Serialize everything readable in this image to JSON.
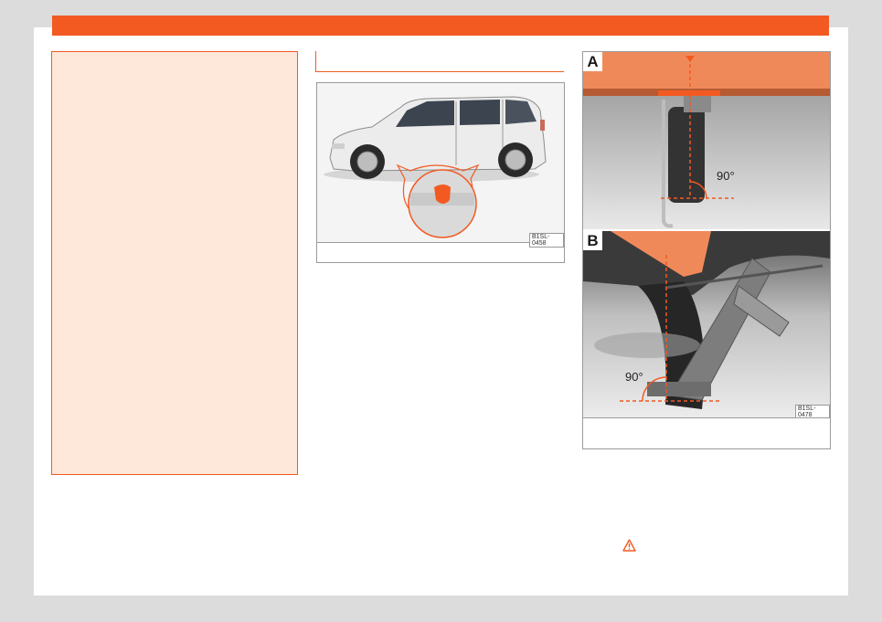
{
  "colors": {
    "accent": "#f25a22",
    "warning_bg": "#fee8da",
    "page_bg": "#ffffff",
    "surround": "#dcdcdc"
  },
  "figure_car": {
    "code": "B1SL-0458"
  },
  "figure_jack": {
    "panel_a": {
      "letter": "A",
      "angle": "90°"
    },
    "panel_b": {
      "letter": "B",
      "angle": "90°"
    },
    "code": "B1SL-0478"
  },
  "icons": {
    "warning": "warning-triangle-icon"
  }
}
